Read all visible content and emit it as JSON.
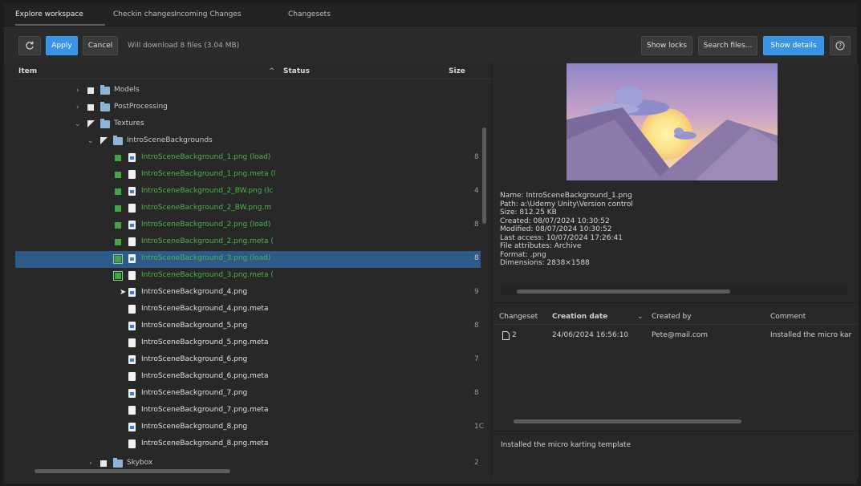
{
  "tabs": [
    {
      "label": "Explore workspace",
      "active": true
    },
    {
      "label": "Checkin changes",
      "active": false
    },
    {
      "label": "Incoming Changes",
      "active": false
    },
    {
      "label": "Changesets",
      "active": false
    }
  ],
  "toolbar": {
    "refresh_icon": "refresh-icon",
    "apply_label": "Apply",
    "cancel_label": "Cancel",
    "status": "Will download 8 files (3.04 MB)",
    "show_locks_label": "Show locks",
    "search_files_label": "Search files...",
    "show_details_label": "Show details",
    "help_icon": "help-icon",
    "accent": "#3993e6"
  },
  "tree": {
    "columns": {
      "item": "Item",
      "status": "Status",
      "size": "Size"
    },
    "rows": [
      {
        "label": "Models",
        "size": ""
      },
      {
        "label": "PostProcessing",
        "size": ""
      },
      {
        "label": "Textures",
        "size": ""
      },
      {
        "label": "IntroSceneBackgrounds",
        "size": ""
      },
      {
        "label": "IntroSceneBackground_1.png (load)",
        "size": "8"
      },
      {
        "label": "IntroSceneBackground_1.png.meta (l",
        "size": ""
      },
      {
        "label": "IntroSceneBackground_2_BW.png (lc",
        "size": "4"
      },
      {
        "label": "IntroSceneBackground_2_BW.png.m",
        "size": ""
      },
      {
        "label": "IntroSceneBackground_2.png (load)",
        "size": "8"
      },
      {
        "label": "IntroSceneBackground_2.png.meta (",
        "size": ""
      },
      {
        "label": "IntroSceneBackground_3.png (load)",
        "size": "8"
      },
      {
        "label": "IntroSceneBackground_3.png.meta (",
        "size": ""
      },
      {
        "label": "IntroSceneBackground_4.png",
        "size": "9"
      },
      {
        "label": "IntroSceneBackground_4.png.meta",
        "size": ""
      },
      {
        "label": "IntroSceneBackground_5.png",
        "size": "8"
      },
      {
        "label": "IntroSceneBackground_5.png.meta",
        "size": ""
      },
      {
        "label": "IntroSceneBackground_6.png",
        "size": "7"
      },
      {
        "label": "IntroSceneBackground_6.png.meta",
        "size": ""
      },
      {
        "label": "IntroSceneBackground_7.png",
        "size": "8"
      },
      {
        "label": "IntroSceneBackground_7.png.meta",
        "size": ""
      },
      {
        "label": "IntroSceneBackground_8.png",
        "size": "1C"
      },
      {
        "label": "IntroSceneBackground_8.png.meta",
        "size": ""
      },
      {
        "label": "Skybox",
        "size": "2"
      }
    ],
    "selected_row": "IntroSceneBackground_3.png (load)"
  },
  "details": {
    "name": "Name: IntroSceneBackground_1.png",
    "path": "Path: a:\\Udemy Unity\\Version control",
    "size": "Size: 812.25 KB",
    "created": "Created: 08/07/2024 10:30:52",
    "modified": "Modified: 08/07/2024 10:30:52",
    "last_access": "Last access: 10/07/2024 17:26:41",
    "attributes": "File attributes: Archive",
    "format": "Format: .png",
    "dimensions": "Dimensions: 2838×1588"
  },
  "changesets": {
    "columns": {
      "changeset": "Changeset",
      "date": "Creation date",
      "created_by": "Created by",
      "comment": "Comment"
    },
    "rows": [
      {
        "id": "2",
        "date": "24/06/2024 16:56:10",
        "created_by": "Pete@mail.com",
        "comment": "Installed the micro kar"
      }
    ],
    "comment_detail": "Installed the micro karting template"
  }
}
